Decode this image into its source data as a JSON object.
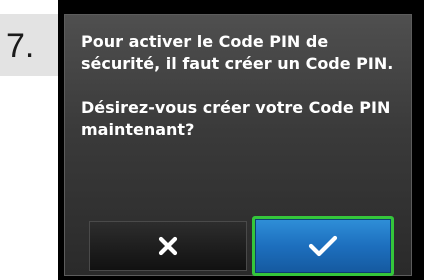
{
  "step": {
    "number": "7."
  },
  "dialog": {
    "message_line_1": "Pour activer le Code PIN de sécurité, il faut créer un Code PIN.",
    "message_line_2": "Désirez-vous créer votre Code PIN maintenant?"
  },
  "buttons": {
    "cancel_icon": "close-icon",
    "confirm_icon": "checkmark-icon"
  },
  "colors": {
    "confirm_button": "#1d6fbe",
    "confirm_highlight_border": "#35c63b",
    "screen_background": "#3a3a3a",
    "device_frame": "#000000",
    "step_badge": "#e3e3e3"
  }
}
